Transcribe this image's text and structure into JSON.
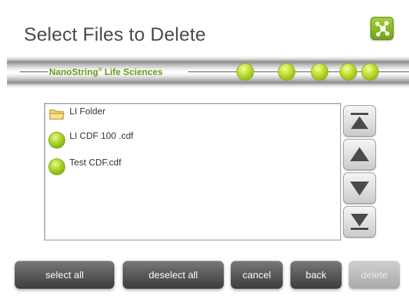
{
  "header": {
    "title": "Select Files to Delete",
    "network_icon": "network-share-icon"
  },
  "banner": {
    "brand": "NanoString",
    "brand_reg": "®",
    "brand_suffix": " Life Sciences",
    "progress_dots": 5
  },
  "files": [
    {
      "label": "LI Folder",
      "icon": "folder-icon"
    },
    {
      "label": "LI CDF 100 .cdf",
      "icon": "green-ball-icon"
    },
    {
      "label": "Test CDF.cdf",
      "icon": "green-ball-icon"
    }
  ],
  "scroll": {
    "icons": [
      "scroll-top-icon",
      "scroll-up-icon",
      "scroll-down-icon",
      "scroll-bottom-icon"
    ]
  },
  "actions": {
    "select_all": "select all",
    "deselect_all": "deselect all",
    "cancel": "cancel",
    "back": "back",
    "delete": "delete"
  },
  "colors": {
    "brand_green": "#6b9a1a",
    "accent_green": "#8fbb10",
    "button_dark": "#4a4a4a",
    "button_disabled": "#bdbdbd"
  }
}
